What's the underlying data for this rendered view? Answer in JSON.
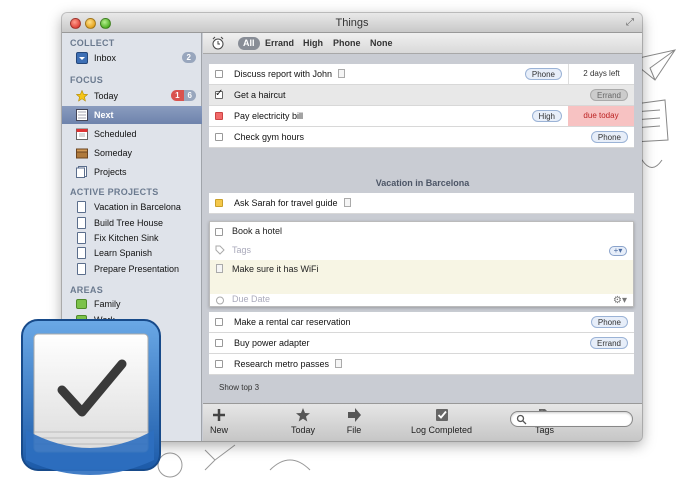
{
  "window": {
    "title": "Things"
  },
  "sidebar": {
    "collect": {
      "heading": "COLLECT",
      "inbox": {
        "label": "Inbox",
        "badge": "2"
      }
    },
    "focus": {
      "heading": "FOCUS",
      "items": [
        {
          "label": "Today",
          "due": "1",
          "count": "6"
        },
        {
          "label": "Next"
        },
        {
          "label": "Scheduled"
        },
        {
          "label": "Someday"
        },
        {
          "label": "Projects"
        }
      ]
    },
    "active_projects": {
      "heading": "ACTIVE PROJECTS",
      "items": [
        "Vacation in Barcelona",
        "Build Tree House",
        "Fix Kitchen Sink",
        "Learn Spanish",
        "Prepare Presentation"
      ]
    },
    "areas": {
      "heading": "AREAS",
      "items": [
        "Family",
        "Work"
      ]
    }
  },
  "filters": [
    "All",
    "Errand",
    "High",
    "Phone",
    "None"
  ],
  "tasks_top": [
    {
      "title": "Discuss report with John",
      "tag": "Phone",
      "due": "2 days left"
    },
    {
      "title": "Get a haircut",
      "tag": "Errand"
    },
    {
      "title": "Pay electricity bill",
      "tag": "High",
      "due": "due today"
    },
    {
      "title": "Check gym hours",
      "tag": "Phone"
    }
  ],
  "group": {
    "title": "Vacation in Barcelona"
  },
  "tasks_group": [
    {
      "title": "Ask Sarah for travel guide"
    }
  ],
  "editor": {
    "title": "Book a hotel",
    "tags_placeholder": "Tags",
    "notes": "Make sure it has WiFi",
    "due_placeholder": "Due Date"
  },
  "tasks_bottom": [
    {
      "title": "Make a rental car reservation",
      "tag": "Phone"
    },
    {
      "title": "Buy power adapter",
      "tag": "Errand"
    },
    {
      "title": "Research metro passes"
    }
  ],
  "show_top": "Show top 3",
  "toolbar": {
    "new": "New",
    "today": "Today",
    "file": "File",
    "log": "Log Completed",
    "tags": "Tags"
  },
  "colors": {
    "accent": "#6e83ac",
    "due_red": "#f7c2c2",
    "sidebar_bg": "#dfe3ea"
  }
}
